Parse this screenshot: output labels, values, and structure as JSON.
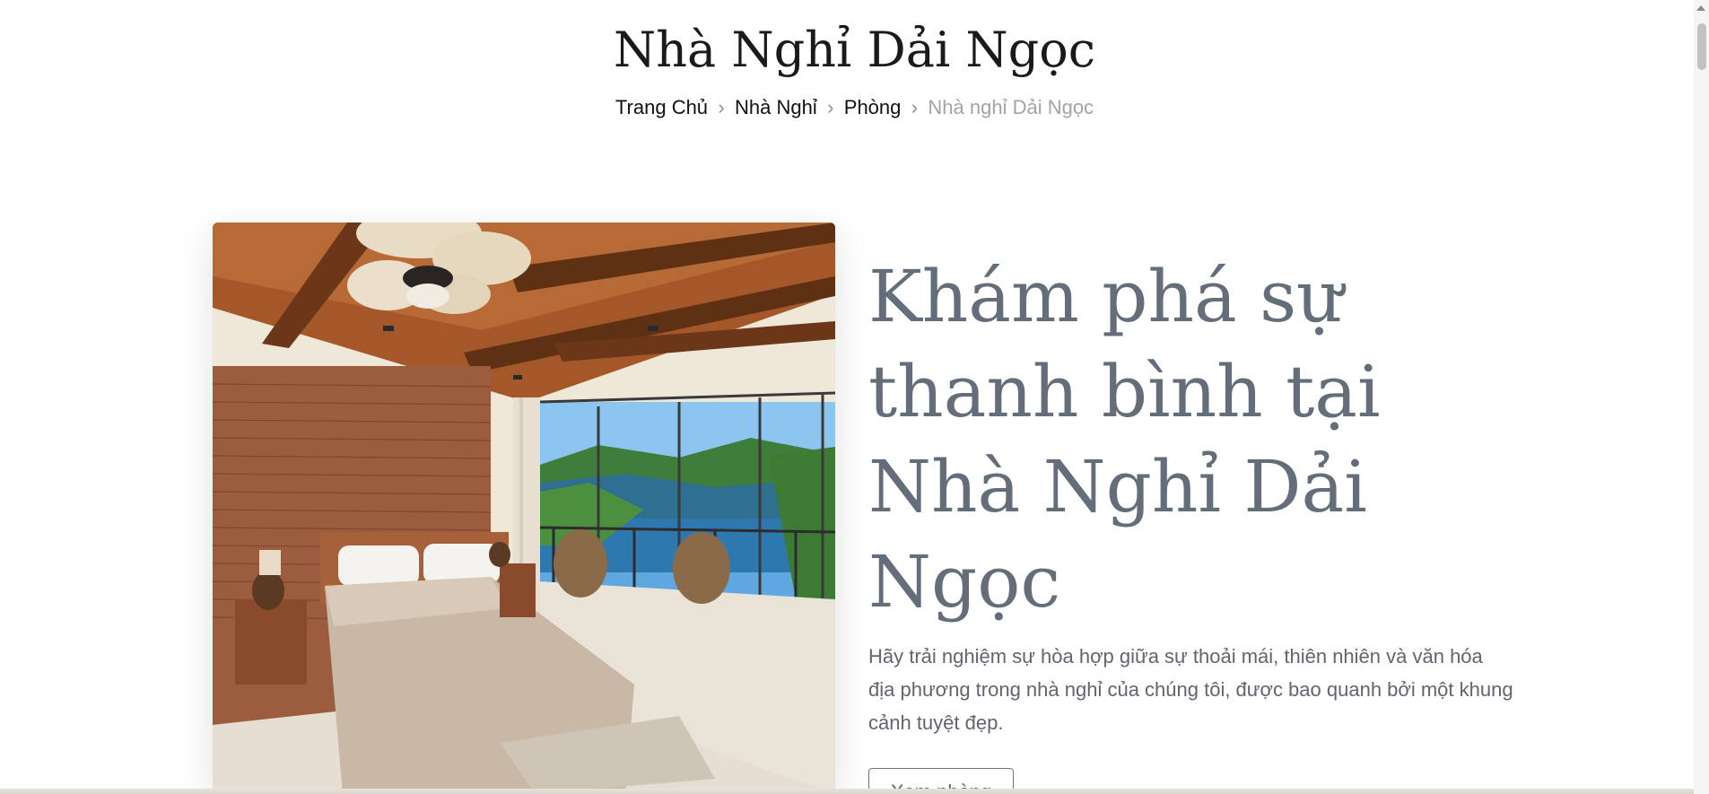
{
  "header": {
    "title": "Nhà Nghỉ Dải Ngọc"
  },
  "breadcrumb": {
    "items": [
      {
        "label": "Trang Chủ"
      },
      {
        "label": "Nhà Nghỉ"
      },
      {
        "label": "Phòng"
      },
      {
        "label": "Nhà nghỉ Dải Ngọc"
      }
    ],
    "separator": "›"
  },
  "hero": {
    "heading": "Khám phá sự thanh bình tại Nhà Nghỉ Dải Ngọc",
    "description": "Hãy trải nghiệm sự hòa hợp giữa sự thoải mái, thiên nhiên và văn hóa địa phương trong nhà nghỉ của chúng tôi, được bao quanh bởi một khung cảnh tuyệt đẹp.",
    "button_label": "Xem phòng"
  },
  "colors": {
    "heading": "#646e7a",
    "text": "#5f6670",
    "breadcrumb_current": "#a0a4ab"
  }
}
